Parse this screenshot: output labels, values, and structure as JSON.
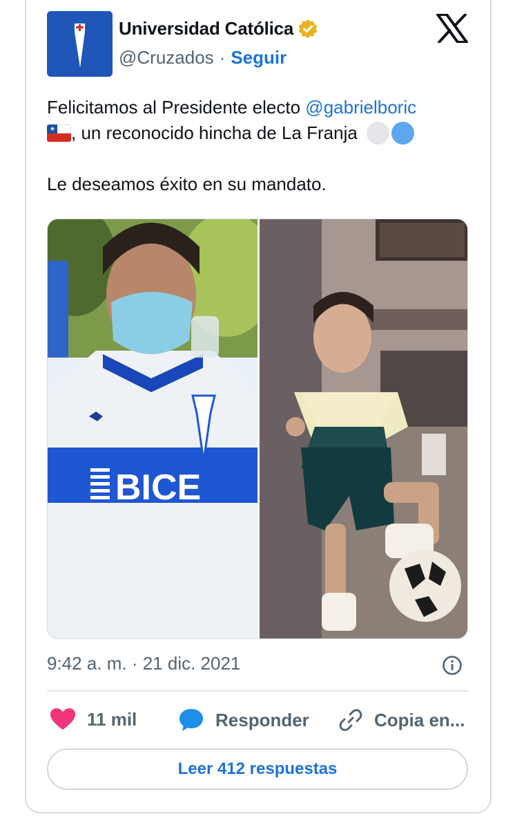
{
  "account": {
    "display_name": "Universidad Católica",
    "handle": "@Cruzados",
    "separator": "·",
    "follow_label": "Seguir",
    "verified_color": "#e8b423",
    "avatar_color": "#1f56b8"
  },
  "tweet": {
    "line1_prefix": "Felicitamos al Presidente electo ",
    "mention": "@gabrielboric",
    "line2_text": ", un reconocido hincha de La Franja ",
    "paragraph2": "Le deseamos éxito en su mandato."
  },
  "meta": {
    "timestamp": "9:42 a. m. · 21 dic. 2021"
  },
  "actions": {
    "like_count": "11 mil",
    "reply_label": "Responder",
    "copy_label": "Copia en..."
  },
  "read_replies_label": "Leer 412 respuestas",
  "colors": {
    "accent": "#1d73d6",
    "like": "#f0357d",
    "reply": "#1d8fe8",
    "muted": "#536471"
  },
  "icons": {
    "verified": "verified-badge-icon",
    "brand": "x-logo-icon",
    "info": "info-icon",
    "like": "heart-icon",
    "reply": "speech-bubble-icon",
    "copy": "link-icon"
  }
}
